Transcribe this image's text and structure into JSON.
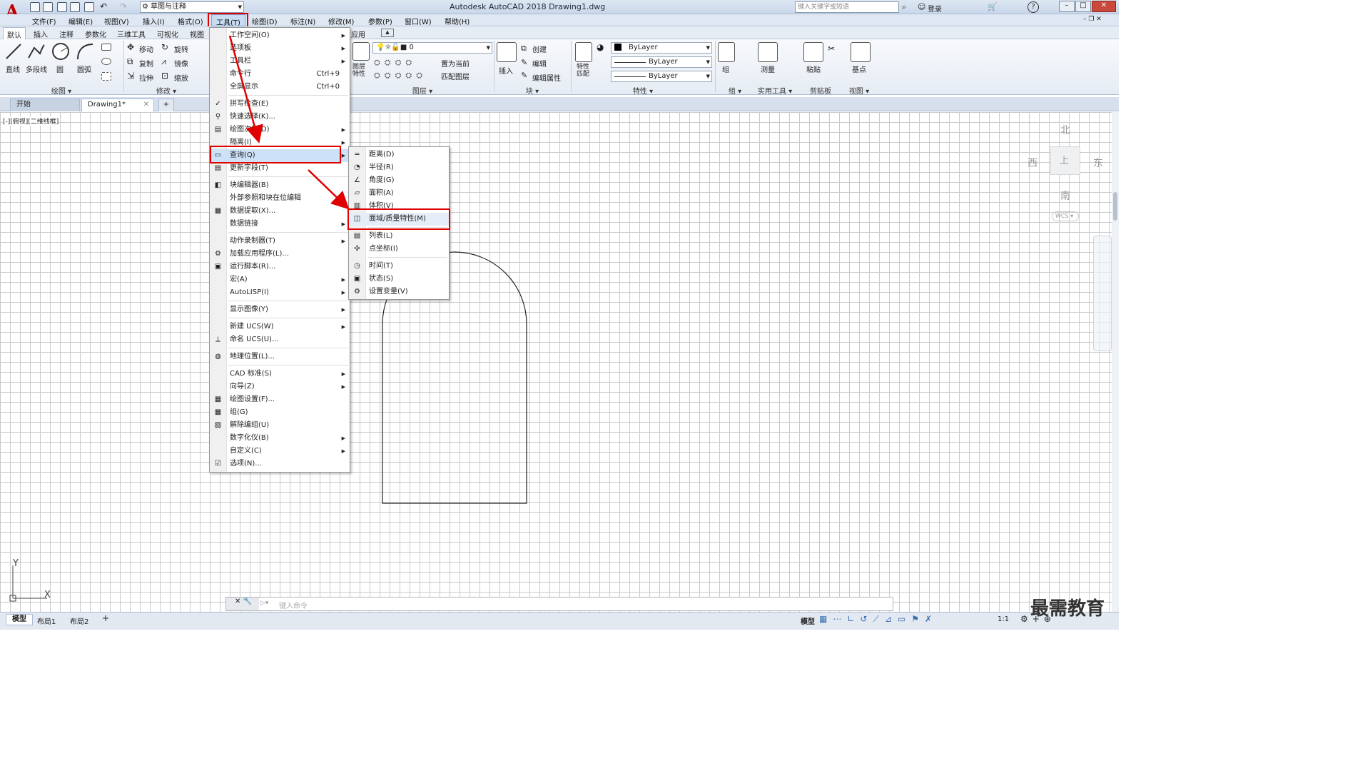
{
  "app": {
    "logo_letter": "A",
    "title": "Autodesk AutoCAD 2018    Drawing1.dwg",
    "workspace": "草图与注释",
    "search_placeholder": "键入关键字或短语",
    "login": "登录"
  },
  "menubar": [
    "文件(F)",
    "编辑(E)",
    "视图(V)",
    "插入(I)",
    "格式(O)",
    "工具(T)",
    "绘图(D)",
    "标注(N)",
    "修改(M)",
    "参数(P)",
    "窗口(W)",
    "帮助(H)"
  ],
  "ribbon_tabs": [
    "默认",
    "插入",
    "注释",
    "参数化",
    "三维工具",
    "可视化",
    "视图",
    "应用"
  ],
  "ribbon": {
    "draw": {
      "title": "绘图",
      "items": [
        "直线",
        "多段线",
        "圆",
        "圆弧"
      ]
    },
    "modify": {
      "title": "修改",
      "items": [
        "移动",
        "旋转",
        "复制",
        "镜像",
        "拉伸",
        "缩放"
      ]
    },
    "layers": {
      "title": "图层",
      "label": "图层\n特性",
      "current": "0",
      "set_current": "置为当前",
      "match_layer": "匹配图层"
    },
    "block": {
      "title": "块",
      "insert": "插入",
      "create": "创建",
      "edit": "编辑",
      "edit_attr": "编辑属性"
    },
    "properties": {
      "title": "特性",
      "match": "特性\n匹配",
      "color": "ByLayer",
      "linetype": "ByLayer",
      "lineweight": "ByLayer"
    },
    "groups": {
      "title": "组",
      "label": "组"
    },
    "utilities": {
      "title": "实用工具",
      "label": "测量"
    },
    "clipboard": {
      "title": "剪贴板",
      "label": "粘贴"
    },
    "view": {
      "title": "视图",
      "label": "基点"
    }
  },
  "doc_tabs": [
    "开始",
    "Drawing1*"
  ],
  "view_label": "[-][俯视][二维线框]",
  "tools_menu": [
    {
      "label": "工作空间(O)",
      "sub": true
    },
    {
      "label": "选项板",
      "sub": true
    },
    {
      "label": "工具栏",
      "sub": true
    },
    {
      "label": "命令行",
      "shortcut": "Ctrl+9"
    },
    {
      "label": "全屏显示",
      "shortcut": "Ctrl+0"
    },
    {
      "label": "拼写检查(E)"
    },
    {
      "label": "快速选择(K)..."
    },
    {
      "label": "绘图次序(D)",
      "sub": true
    },
    {
      "label": "隔离(I)",
      "sub": true
    },
    {
      "label": "查询(Q)",
      "sub": true
    },
    {
      "label": "更新字段(T)"
    },
    {
      "label": "块编辑器(B)"
    },
    {
      "label": "外部参照和块在位编辑",
      "sub": true
    },
    {
      "label": "数据提取(X)..."
    },
    {
      "label": "数据链接",
      "sub": true
    },
    {
      "label": "动作录制器(T)",
      "sub": true
    },
    {
      "label": "加载应用程序(L)..."
    },
    {
      "label": "运行脚本(R)..."
    },
    {
      "label": "宏(A)",
      "sub": true
    },
    {
      "label": "AutoLISP(I)",
      "sub": true
    },
    {
      "label": "显示图像(Y)",
      "sub": true
    },
    {
      "label": "新建 UCS(W)",
      "sub": true
    },
    {
      "label": "命名 UCS(U)..."
    },
    {
      "label": "地理位置(L)..."
    },
    {
      "label": "CAD 标准(S)",
      "sub": true
    },
    {
      "label": "向导(Z)",
      "sub": true
    },
    {
      "label": "绘图设置(F)..."
    },
    {
      "label": "组(G)"
    },
    {
      "label": "解除编组(U)"
    },
    {
      "label": "数字化仪(B)",
      "sub": true
    },
    {
      "label": "自定义(C)",
      "sub": true
    },
    {
      "label": "选项(N)..."
    }
  ],
  "inquiry_menu": [
    "距离(D)",
    "半径(R)",
    "角度(G)",
    "面积(A)",
    "体积(V)",
    "面域/质量特性(M)",
    "列表(L)",
    "点坐标(I)",
    "时间(T)",
    "状态(S)",
    "设置变量(V)"
  ],
  "viewcube": {
    "north": "北",
    "south": "南",
    "east": "东",
    "west": "西",
    "top": "上",
    "wcs": "WCS"
  },
  "ucs": {
    "x": "X",
    "y": "Y"
  },
  "command_placeholder": "键入命令",
  "layout_tabs": [
    "模型",
    "布局1",
    "布局2"
  ],
  "status": {
    "model": "模型",
    "scale": "1:1"
  },
  "watermark": "最需教育"
}
